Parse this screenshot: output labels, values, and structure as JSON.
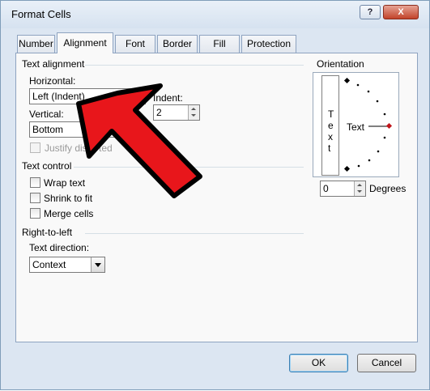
{
  "window": {
    "title": "Format Cells",
    "help_label": "?",
    "close_label": "X"
  },
  "tabs": [
    "Number",
    "Alignment",
    "Font",
    "Border",
    "Fill",
    "Protection"
  ],
  "text_alignment": {
    "group_label": "Text alignment",
    "horizontal_label": "Horizontal:",
    "horizontal_value": "Left (Indent)",
    "indent_label": "Indent:",
    "indent_value": "2",
    "vertical_label": "Vertical:",
    "vertical_value": "Bottom",
    "justify_label_visible": "Justify dis",
    "justify_label_tail": "ted"
  },
  "text_control": {
    "group_label": "Text control",
    "wrap_label": "Wrap text",
    "shrink_label": "Shrink to fit",
    "merge_label": "Merge cells"
  },
  "rtl": {
    "group_label": "Right-to-left",
    "direction_label": "Text direction:",
    "direction_value": "Context"
  },
  "orientation": {
    "group_label": "Orientation",
    "vertical_letters": [
      "T",
      "e",
      "x",
      "t"
    ],
    "text_label": "Text",
    "degrees_value": "0",
    "degrees_label": "Degrees"
  },
  "buttons": {
    "ok": "OK",
    "cancel": "Cancel"
  },
  "annotation": {
    "arrow_color": "#e8161b",
    "outline_color": "#000000"
  }
}
